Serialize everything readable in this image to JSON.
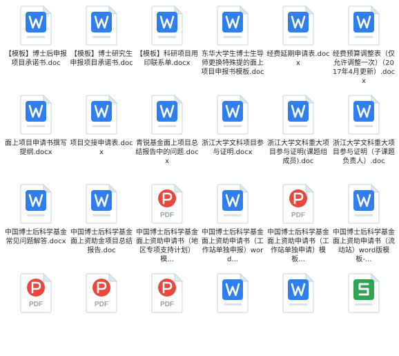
{
  "colors": {
    "word": "#2e7ef0",
    "pdf": "#e8473d",
    "sheet": "#2da44e",
    "page_bg": "#ffffff",
    "text": "#2a2a2a"
  },
  "files": [
    {
      "name": "【模板】博士后申报项目承诺书.doc",
      "icon": "word-document-icon"
    },
    {
      "name": "【模板】博士研究生申报项目承诺书.doc",
      "icon": "word-document-icon"
    },
    {
      "name": "【模板】科研项目用印联系单.docx",
      "icon": "word-document-icon"
    },
    {
      "name": "东华大学生博士生导师更换特殊提的面上项目申报书模板.doc",
      "icon": "word-document-icon"
    },
    {
      "name": "经费延期申请表.docx",
      "icon": "word-document-icon"
    },
    {
      "name": "经费预算调整表（仅允许调整一次）（2017年4月更新）.docx",
      "icon": "word-document-icon"
    },
    {
      "name": "面上项目申请书撰写提纲.docx",
      "icon": "word-document-icon"
    },
    {
      "name": "项目交接申请表.docx",
      "icon": "word-document-icon"
    },
    {
      "name": "青锐基金面上项目总结报告中的问题.docx",
      "icon": "word-document-icon"
    },
    {
      "name": "浙江大学文科项目参与证明.docx",
      "icon": "word-document-icon"
    },
    {
      "name": "浙江大学文科重大项目参与证明(课题组成员).doc",
      "icon": "word-document-icon"
    },
    {
      "name": "浙江大学文科重大项目参与证明（子课题负责人）.doc",
      "icon": "word-document-icon"
    },
    {
      "name": "中国博士后科学基金常见问题解答.docx",
      "icon": "word-document-icon"
    },
    {
      "name": "中国博士后科学基金面上资助金项目总结报告.doc",
      "icon": "word-document-icon"
    },
    {
      "name": "中国博士后科学基金面上资助申请书（地区专项支持计划）模...",
      "icon": "pdf-document-icon"
    },
    {
      "name": "中国博士后科学基金面上资助申请书（工作站单独申报）word...",
      "icon": "word-document-icon"
    },
    {
      "name": "中国博士后科学基金面上资助申请书（工作站单独申请）模板...",
      "icon": "pdf-document-icon"
    },
    {
      "name": "中国博士后科学基金面上资助申请书（流动站）word版模板-...",
      "icon": "word-document-icon"
    },
    {
      "name": "",
      "icon": "pdf-document-icon"
    },
    {
      "name": "",
      "icon": "pdf-document-icon"
    },
    {
      "name": "",
      "icon": "pdf-document-icon"
    },
    {
      "name": "",
      "icon": "word-document-icon"
    },
    {
      "name": "",
      "icon": "word-document-icon"
    },
    {
      "name": "",
      "icon": "spreadsheet-icon"
    }
  ]
}
